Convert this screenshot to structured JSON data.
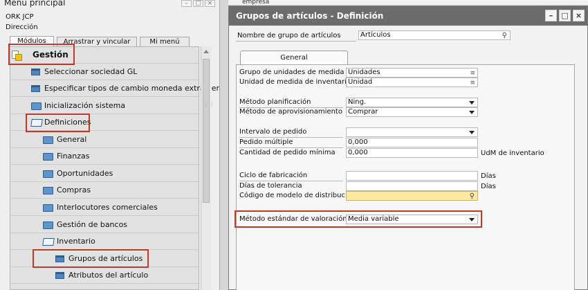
{
  "main_menu": {
    "title": "Menú principal",
    "user": "ORK JCP",
    "role": "Dirección",
    "tabs": [
      "Módulos",
      "Arrastrar y vincular",
      "Mi menú"
    ],
    "tree": [
      {
        "label": "Gestión",
        "icon": "module-icon"
      },
      {
        "label": "Seleccionar sociedad GL",
        "icon": "document-icon"
      },
      {
        "label": "Especificar tipos de cambio moneda extranjera",
        "icon": "document-icon"
      },
      {
        "label": "Inicialización sistema",
        "icon": "folder-icon"
      },
      {
        "label": "Definiciones",
        "icon": "folder-open-icon"
      },
      {
        "label": "General",
        "icon": "folder-icon"
      },
      {
        "label": "Finanzas",
        "icon": "folder-icon"
      },
      {
        "label": "Oportunidades",
        "icon": "folder-icon"
      },
      {
        "label": "Compras",
        "icon": "folder-icon"
      },
      {
        "label": "Interlocutores comerciales",
        "icon": "folder-icon"
      },
      {
        "label": "Gestión de bancos",
        "icon": "folder-icon"
      },
      {
        "label": "Inventario",
        "icon": "folder-open-icon"
      },
      {
        "label": "Grupos de artículos",
        "icon": "document-icon"
      },
      {
        "label": "Atributos del artículo",
        "icon": "document-icon"
      }
    ]
  },
  "background_window": {
    "title_fragment": "empresa"
  },
  "definition_window": {
    "title": "Grupos de artículos - Definición",
    "group_name_label": "Nombre de grupo de artículos",
    "group_name_value": "Artículos",
    "tab_general": "General",
    "fields": {
      "uom_group_label": "Grupo de unidades de medida",
      "uom_group_value": "Unidades",
      "inventory_uom_label": "Unidad de medida de inventario es",
      "inventory_uom_value": "Unidad",
      "planning_method_label": "Método planificación",
      "planning_method_value": "Ning.",
      "procurement_method_label": "Método de aprovisionamiento",
      "procurement_method_value": "Comprar",
      "order_interval_label": "Intervalo de pedido",
      "order_interval_value": "",
      "order_multiple_label": "Pedido múltiple",
      "order_multiple_value": "0,000",
      "min_order_qty_label": "Cantidad de pedido mínima",
      "min_order_qty_value": "0,000",
      "min_order_qty_unit": "UdM de inventario",
      "lead_time_label": "Ciclo de fabricación",
      "lead_time_unit": "Días",
      "tolerance_days_label": "Días de tolerancia",
      "tolerance_days_unit": "Días",
      "distribution_rule_label": "Código de modelo de distribuc",
      "valuation_method_label": "Método estándar de valoración",
      "valuation_method_value": "Media variable"
    }
  },
  "colors": {
    "highlight": "#c0392b",
    "title_bar": "#6c6c6c",
    "tree_bg": "#e2e2e2",
    "required_field": "#fdeaa0"
  }
}
